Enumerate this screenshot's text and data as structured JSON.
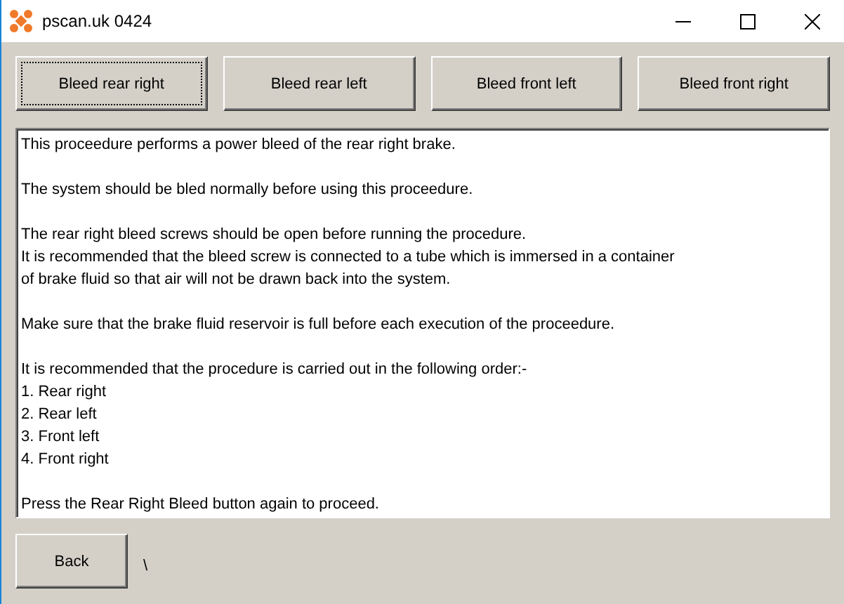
{
  "window": {
    "title": "pscan.uk 0424"
  },
  "bleed_buttons": [
    {
      "label": "Bleed rear right",
      "focused": true
    },
    {
      "label": "Bleed rear left",
      "focused": false
    },
    {
      "label": "Bleed front left",
      "focused": false
    },
    {
      "label": "Bleed front right",
      "focused": false
    }
  ],
  "message_paragraphs": [
    [
      "This proceedure performs a power bleed of the rear right brake."
    ],
    [
      "The system should be bled normally before using this proceedure."
    ],
    [
      "The rear right bleed screws should be open before running the procedure.",
      "It is recommended that the bleed screw is connected to a tube which is immersed in a container",
      "of brake fluid so that air will not be drawn back into the system."
    ],
    [
      "Make sure that the brake fluid reservoir is full before each execution of the proceedure."
    ],
    [
      "It is recommended that the procedure is carried out in the following order:-",
      "1. Rear right",
      "2. Rear left",
      "3. Front left",
      "4. Front right"
    ],
    [
      "Press the Rear Right Bleed button again to proceed."
    ]
  ],
  "back_button": {
    "label": "Back"
  },
  "status_text": "\\"
}
